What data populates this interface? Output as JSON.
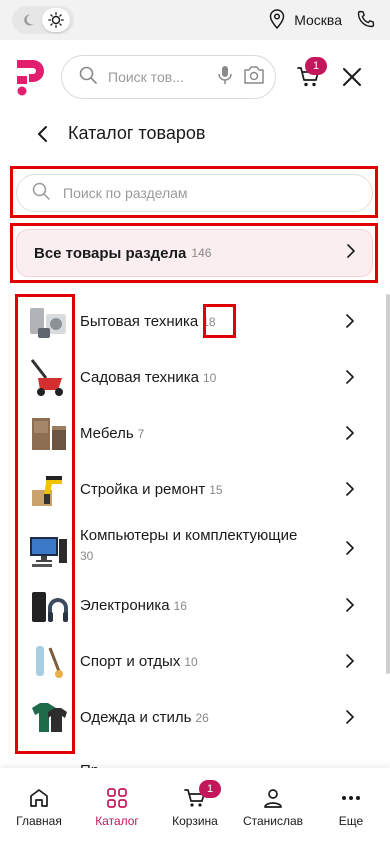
{
  "status_bar": {
    "theme_toggle": {
      "moon_icon": "moon-icon",
      "sun_icon": "sun-icon",
      "active": "light"
    },
    "location_icon": "location-pin-icon",
    "city": "Москва",
    "phone_icon": "phone-icon"
  },
  "header": {
    "logo": "brand-logo",
    "search": {
      "placeholder": "Поиск тов...",
      "search_icon": "search-icon",
      "mic_icon": "microphone-icon",
      "camera_icon": "camera-icon"
    },
    "cart_badge": "1",
    "close_icon": "close-icon"
  },
  "catalog": {
    "title": "Каталог товаров",
    "back_icon": "chevron-left-icon",
    "section_search": {
      "placeholder": "Поиск по разделам"
    },
    "all_products": {
      "label": "Все товары раздела",
      "count": "146"
    },
    "categories": [
      {
        "label": "Бытовая техника",
        "count": "18"
      },
      {
        "label": "Садовая техника",
        "count": "10"
      },
      {
        "label": "Мебель",
        "count": "7"
      },
      {
        "label": "Стройка и ремонт",
        "count": "15"
      },
      {
        "label": "Компьютеры и комплектующие",
        "count": "30"
      },
      {
        "label": "Электроника",
        "count": "16"
      },
      {
        "label": "Спорт и отдых",
        "count": "10"
      },
      {
        "label": "Одежда и стиль",
        "count": "26"
      }
    ],
    "partial_item": "Пр..."
  },
  "bottom_nav": [
    {
      "label": "Главная",
      "icon": "home-icon",
      "active": false
    },
    {
      "label": "Каталог",
      "icon": "grid-icon",
      "active": true
    },
    {
      "label": "Корзина",
      "icon": "cart-icon",
      "active": false,
      "badge": "1"
    },
    {
      "label": "Станислав",
      "icon": "user-icon",
      "active": false
    },
    {
      "label": "Еще",
      "icon": "more-icon",
      "active": false
    }
  ],
  "colors": {
    "accent": "#c2185b",
    "highlight_frame": "#e00000",
    "all_btn_bg": "#fbeef1"
  }
}
